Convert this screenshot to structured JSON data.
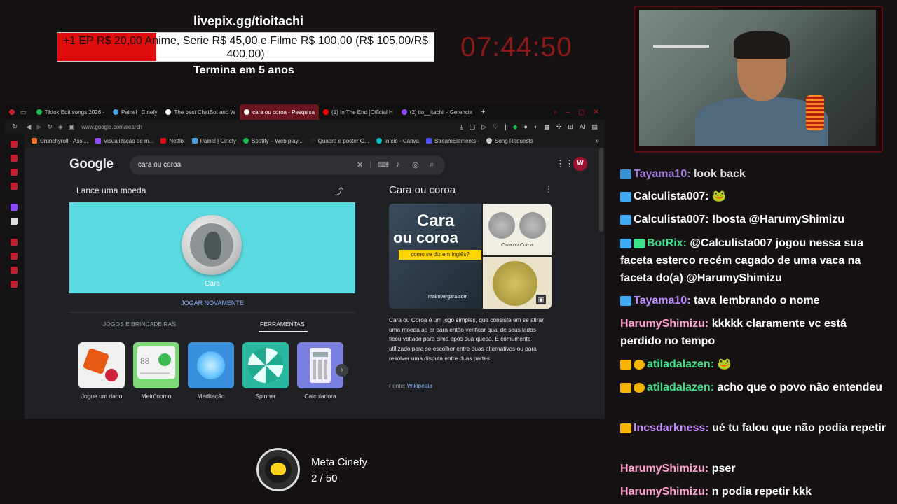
{
  "overlay": {
    "donate_url": "livepix.gg/tioitachi",
    "goal_text": "+1 EP R$ 20,00 Anime, Serie R$ 45,00 e Filme R$ 100,00 (R$ 105,00/R$ 400,00)",
    "goal_progress": 0.2625,
    "goal_ends": "Termina em 5 anos",
    "timer": "07:44:50",
    "colors": {
      "goal_fill": "#e00d0d",
      "timer": "#8a1a1a"
    }
  },
  "browser": {
    "tabs": [
      {
        "label": "Tiktok Edit songs 2026 -",
        "icon_color": "#1db954",
        "active": false
      },
      {
        "label": "Painel | Cinefy",
        "icon_color": "#4aa3df",
        "active": false
      },
      {
        "label": "The best ChatBot and W",
        "icon_color": "#ffffff",
        "active": false
      },
      {
        "label": "cara ou coroa - Pesquisa",
        "icon_color": "#ffffff",
        "active": true
      },
      {
        "label": "(1) In The End [Official H",
        "icon_color": "#ff0000",
        "active": false
      },
      {
        "label": "(2) tio__itachii - Gerencia",
        "icon_color": "#9147ff",
        "active": false
      }
    ],
    "new_tab": "+",
    "url": "www.google.com/search",
    "bookmarks": [
      {
        "label": "Crunchyroll - Assi...",
        "icon_color": "#f47521"
      },
      {
        "label": "Visualização de m...",
        "icon_color": "#9147ff"
      },
      {
        "label": "Netflix",
        "icon_color": "#e50914"
      },
      {
        "label": "Painel | Cinefy",
        "icon_color": "#4aa3df"
      },
      {
        "label": "Spotify – Web play...",
        "icon_color": "#1db954"
      },
      {
        "label": "Quadro e poster G...",
        "icon_color": "#222222"
      },
      {
        "label": "Início - Canva",
        "icon_color": "#00c4cc"
      },
      {
        "label": "StreamElements -",
        "icon_color": "#4a55ff"
      },
      {
        "label": "Song Requests",
        "icon_color": "#cccccc"
      }
    ]
  },
  "google": {
    "logo": "Google",
    "query": "cara ou coroa",
    "avatar_letter": "W",
    "coin_card": {
      "title": "Lance uma moeda",
      "coin_label": "Cara",
      "replay": "JOGAR NOVAMENTE",
      "tab_games": "JOGOS E BRINCADEIRAS",
      "tab_tools": "FERRAMENTAS",
      "tools": [
        "Jogue um dado",
        "Metrônomo",
        "Meditação",
        "Spinner",
        "Calculadora"
      ],
      "metronome_value": "88",
      "colors": {
        "coin_bg": "#5ad9e0"
      }
    },
    "knowledge_panel": {
      "title": "Cara ou coroa",
      "image_title_1": "Cara",
      "image_title_2": "ou coroa",
      "image_subtitle": "como se diz em inglês?",
      "image_brand": "mairovergara.com",
      "image_caption": "Cara ou Coroa",
      "description": "Cara ou Coroa é um jogo simples, que consiste em se atirar uma moeda ao ar para então verificar qual de seus lados ficou voltado para cima após sua queda. É comumente utilizado para se escolher entre duas alternativas ou para resolver uma disputa entre duas partes.",
      "source_label": "Fonte:",
      "source_link": "Wikipédia"
    }
  },
  "meta": {
    "title": "Meta Cinefy",
    "count": "2 / 50"
  },
  "chat": [
    {
      "user": "Tayama10:",
      "text": "look back",
      "color": "#b98cff",
      "badge": "sword"
    },
    {
      "user": "Calculista007:",
      "text": "🐸",
      "color": "#ffffff",
      "badge": "sword"
    },
    {
      "user": "Calculista007:",
      "text": "!bosta @HarumyShimizu",
      "color": "#ffffff",
      "badge": "sword"
    },
    {
      "user": "BotRix:",
      "text": "@Calculista007 jogou nessa sua faceta esterco recém cagado de uma vaca na faceta do(a) @HarumyShimizu",
      "color": "#3ee08a",
      "badge": "sword-bot"
    },
    {
      "user": "Tayama10:",
      "text": "tava lembrando o nome",
      "color": "#b98cff",
      "badge": "sword"
    },
    {
      "user": "HarumyShimizu:",
      "text": "kkkkk claramente vc está perdido no tempo",
      "color": "#ff9fcf",
      "badge": ""
    },
    {
      "user": "atiladalazen:",
      "text": "🐸",
      "color": "#3ee08a",
      "badge": "crown-1"
    },
    {
      "user": "atiladalazen:",
      "text": "acho que o povo não entendeu",
      "color": "#3ee08a",
      "badge": "crown-1"
    },
    {
      "user": "Incsdarkness:",
      "text": "ué tu falou que não podia repetir",
      "color": "#c58cff",
      "badge": "crown"
    },
    {
      "user": "HarumyShimizu:",
      "text": "pser",
      "color": "#ff9fcf",
      "badge": ""
    },
    {
      "user": "HarumyShimizu:",
      "text": "n podia repetir kkk",
      "color": "#ff9fcf",
      "badge": ""
    }
  ]
}
